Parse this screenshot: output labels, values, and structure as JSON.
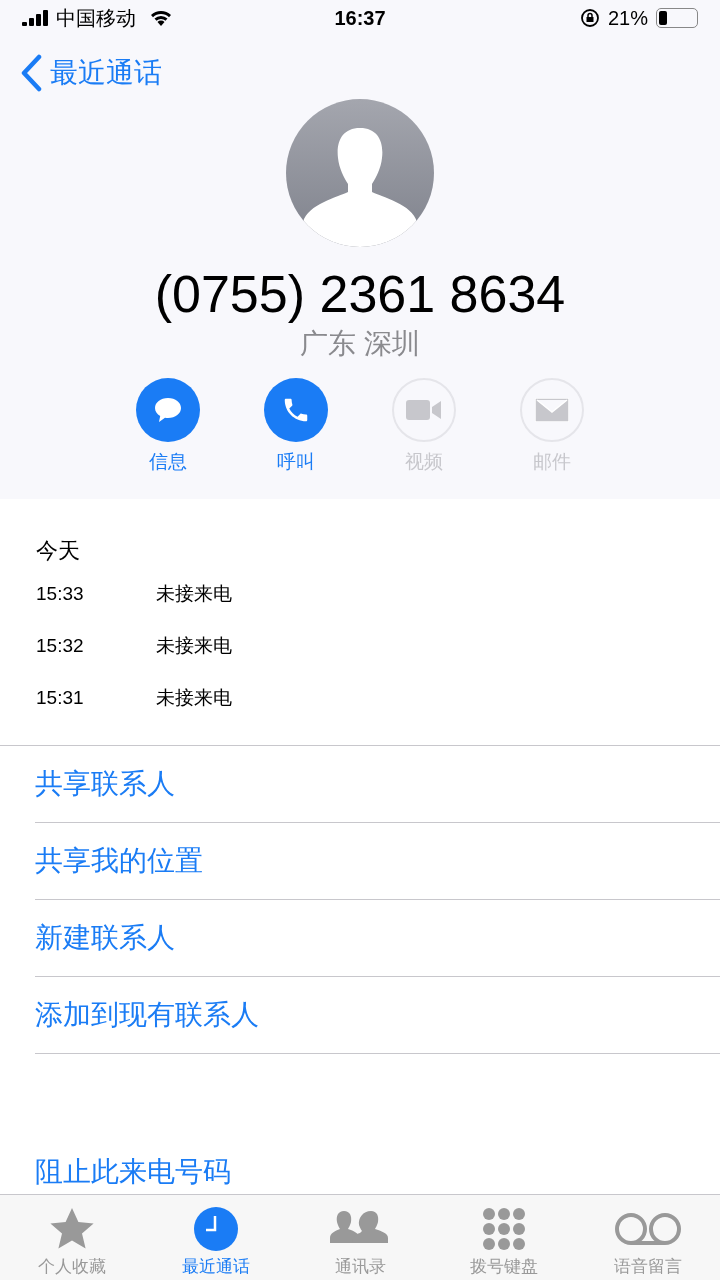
{
  "status_bar": {
    "carrier": "中国移动",
    "time": "16:37",
    "battery": "21%"
  },
  "nav": {
    "back": "最近通话"
  },
  "contact": {
    "number": "(0755) 2361 8634",
    "location": "广东 深圳"
  },
  "actions": [
    {
      "kind": "message",
      "label": "信息",
      "disabled": false
    },
    {
      "kind": "call",
      "label": "呼叫",
      "disabled": false
    },
    {
      "kind": "video",
      "label": "视频",
      "disabled": true
    },
    {
      "kind": "mail",
      "label": "邮件",
      "disabled": true
    }
  ],
  "history": {
    "heading": "今天",
    "rows": [
      {
        "time": "15:33",
        "type": "未接来电"
      },
      {
        "time": "15:32",
        "type": "未接来电"
      },
      {
        "time": "15:31",
        "type": "未接来电"
      }
    ]
  },
  "options": [
    "共享联系人",
    "共享我的位置",
    "新建联系人",
    "添加到现有联系人"
  ],
  "block": "阻止此来电号码",
  "tabs": [
    {
      "kind": "favorites",
      "label": "个人收藏",
      "selected": false
    },
    {
      "kind": "recents",
      "label": "最近通话",
      "selected": true
    },
    {
      "kind": "contacts",
      "label": "通讯录",
      "selected": false
    },
    {
      "kind": "keypad",
      "label": "拨号键盘",
      "selected": false
    },
    {
      "kind": "voicemail",
      "label": "语音留言",
      "selected": false
    }
  ]
}
